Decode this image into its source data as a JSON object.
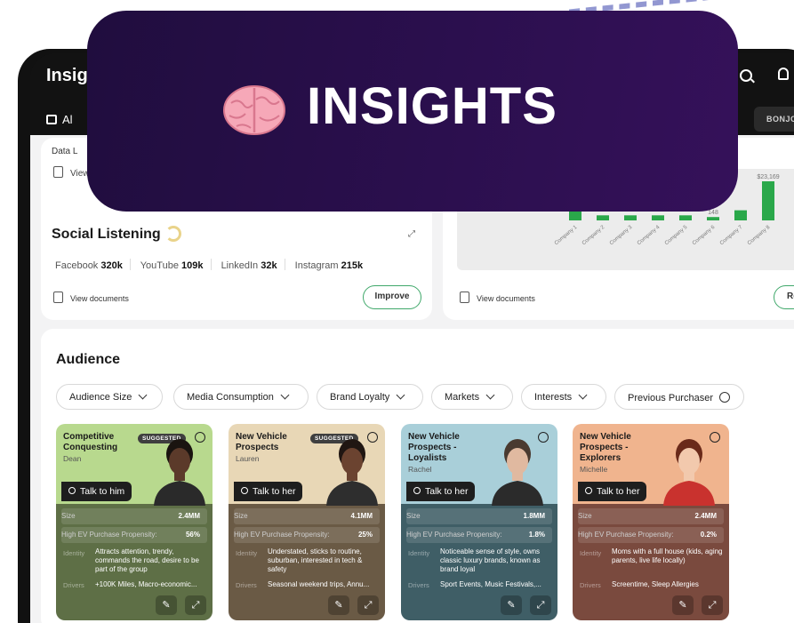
{
  "app": {
    "logo_text": "Insig",
    "tab_all": "Al",
    "brand_tab": "BONJO"
  },
  "banner": {
    "title": "INSIGHTS",
    "icon": "brain-icon"
  },
  "top_left": {
    "data_label": "Data L",
    "view_label": "View"
  },
  "social": {
    "title": "Social Listening",
    "stats": [
      {
        "platform": "Facebook",
        "value": "320k"
      },
      {
        "platform": "YouTube",
        "value": "109k"
      },
      {
        "platform": "LinkedIn",
        "value": "32k"
      },
      {
        "platform": "Instagram",
        "value": "215k"
      }
    ],
    "view_docs": "View documents",
    "improve": "Improve"
  },
  "chart_card": {
    "view_docs": "View documents",
    "button_partial": "Re"
  },
  "chart_data": {
    "type": "bar",
    "categories": [
      "Company 1",
      "Company 2",
      "Company 3",
      "Company 4",
      "Company 5",
      "Company 6",
      "Company 7",
      "Company 8"
    ],
    "values": [
      12,
      3,
      3,
      3,
      3,
      2,
      6,
      23.169
    ],
    "data_labels": [
      "",
      "",
      "",
      "",
      "",
      "148",
      "",
      "$23,169"
    ],
    "colors": {
      "bar": "#2aa84a"
    }
  },
  "audience": {
    "title": "Audience",
    "filters": [
      {
        "label": "Audience Size",
        "icon": "chevron-down-icon"
      },
      {
        "label": "Media Consumption",
        "icon": "chevron-down-icon"
      },
      {
        "label": "Brand Loyalty",
        "icon": "chevron-down-icon"
      },
      {
        "label": "Markets",
        "icon": "chevron-down-icon"
      },
      {
        "label": "Interests",
        "icon": "chevron-down-icon"
      },
      {
        "label": "Previous Purchaser",
        "icon": "check-circle-icon"
      }
    ],
    "cards": [
      {
        "name": "Competitive Conquesting",
        "person": "Dean",
        "badge": "SUGGESTED",
        "talk": "Talk to him",
        "size_label": "Size",
        "size": "2.4MM",
        "prop_label": "High EV Purchase Propensity:",
        "prop": "56%",
        "identity_label": "Identity",
        "identity": "Attracts attention, trendy, commands the road, desire to be part of the group",
        "drivers_label": "Drivers",
        "drivers": "+100K Miles, Macro-economic...",
        "top_color": "#b8d98e",
        "bottom_color": "#5e6f46"
      },
      {
        "name": "New Vehicle Prospects",
        "person": "Lauren",
        "badge": "SUGGESTED",
        "talk": "Talk to her",
        "size_label": "Size",
        "size": "4.1MM",
        "prop_label": "High EV Purchase Propensity:",
        "prop": "25%",
        "identity_label": "Identity",
        "identity": "Understated, sticks to routine, suburban, interested in tech & safety",
        "drivers_label": "Drivers",
        "drivers": "Seasonal weekend trips, Annu...",
        "top_color": "#e8d7b6",
        "bottom_color": "#6a5a45"
      },
      {
        "name": "New Vehicle Prospects - Loyalists",
        "person": "Rachel",
        "badge": "",
        "talk": "Talk to her",
        "size_label": "Size",
        "size": "1.8MM",
        "prop_label": "High EV Purchase Propensity:",
        "prop": "1.8%",
        "identity_label": "Identity",
        "identity": "Noticeable sense of style, owns classic luxury brands, known as brand loyal",
        "drivers_label": "Drivers",
        "drivers": "Sport Events, Music Festivals,...",
        "top_color": "#a9cfd9",
        "bottom_color": "#3f5e66"
      },
      {
        "name": "New Vehicle Prospects - Explorers",
        "person": "Michelle",
        "badge": "",
        "talk": "Talk to her",
        "size_label": "Size",
        "size": "2.4MM",
        "prop_label": "High EV Purchase Propensity:",
        "prop": "0.2%",
        "identity_label": "Identity",
        "identity": "Moms with a full house (kids, aging parents, live life locally)",
        "drivers_label": "Drivers",
        "drivers": "Screentime, Sleep Allergies",
        "top_color": "#f0b48e",
        "bottom_color": "#7a4a3e"
      }
    ]
  }
}
